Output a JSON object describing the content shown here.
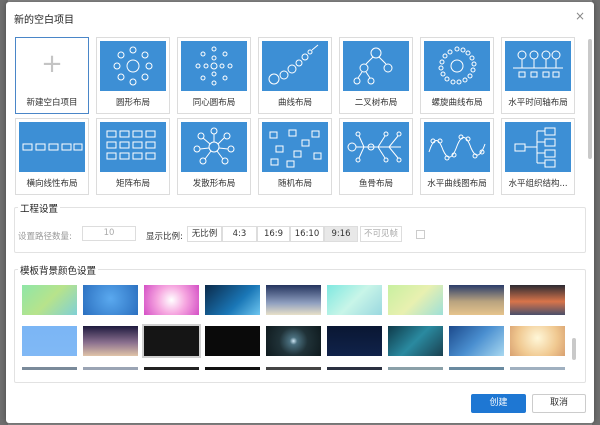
{
  "dialog": {
    "title": "新的空白项目",
    "close_icon": "×"
  },
  "templates": [
    {
      "label": "新建空白项目",
      "icon": "plus-icon",
      "selected": true
    },
    {
      "label": "圆形布局",
      "icon": "circular-layout-icon"
    },
    {
      "label": "同心圆布局",
      "icon": "concentric-layout-icon"
    },
    {
      "label": "曲线布局",
      "icon": "curve-layout-icon"
    },
    {
      "label": "二叉树布局",
      "icon": "binary-tree-layout-icon"
    },
    {
      "label": "螺旋曲线布局",
      "icon": "spiral-layout-icon"
    },
    {
      "label": "水平时间轴布局",
      "icon": "horizontal-timeline-icon"
    },
    {
      "label": "横向线性布局",
      "icon": "horizontal-linear-icon"
    },
    {
      "label": "矩阵布局",
      "icon": "matrix-layout-icon"
    },
    {
      "label": "发散形布局",
      "icon": "radial-layout-icon"
    },
    {
      "label": "随机布局",
      "icon": "random-layout-icon"
    },
    {
      "label": "鱼骨布局",
      "icon": "fishbone-layout-icon"
    },
    {
      "label": "水平曲线图布局",
      "icon": "horizontal-curve-icon"
    },
    {
      "label": "水平组织结构...",
      "icon": "org-chart-icon"
    }
  ],
  "project_settings": {
    "title": "工程设置",
    "path_depth_label": "设置路径数量:",
    "path_depth_value": "10",
    "ratio_label": "显示比例:",
    "ratios": [
      "无比例",
      "4:3",
      "16:9",
      "16:10",
      "9:16"
    ],
    "active_ratio": "9:16",
    "invisible_label": "不可见帧"
  },
  "background": {
    "title": "模板背景颜色设置",
    "swatches": [
      "linear-gradient(135deg,#8fe6a8,#b7e38b,#7fd0d6)",
      "radial-gradient(circle at 50% 45%,#5aa9ef,#2b6fbf)",
      "radial-gradient(circle at 50% 50%,#ffffff,#f6a7e0 45%,#d44fc5)",
      "linear-gradient(135deg,#0b2a4a,#1a77b7 60%,#6ec6f0)",
      "linear-gradient(180deg,#24345e,#8f9fbf 60%,#e8e0c8)",
      "linear-gradient(135deg,#7fe8e0,#c8f5e8,#9ad8e0)",
      "linear-gradient(135deg,#c8f0a0,#e8f0b0,#9ee0d8)",
      "linear-gradient(180deg,#2b3d6a,#b9a37f 55%,#e6c48c)",
      "linear-gradient(180deg,#2c2a32,#d8744a 55%,#4a4f6a)",
      "linear-gradient(180deg,#7bb6f5,#80b8f5)",
      "linear-gradient(180deg,#1e1a3e,#8a6f8e 55%,#e0c4a8)",
      "#151515",
      "#0a0a0a",
      "radial-gradient(circle at 50% 50%,#cfe7f5 0%,#4a6f7e 12%,#203238 45%,#0f1a1e)",
      "linear-gradient(180deg,#0a1733,#10224a)",
      "linear-gradient(135deg,#0e3a4a,#2a8aa0 50%,#1a4050)",
      "linear-gradient(135deg,#1c4a8c,#4a8fd0 50%,#a8d8f0)",
      "radial-gradient(circle at 50% 40%,#fff7d8,#f0c890 60%,#d8a070)"
    ],
    "selected_index": 11
  },
  "buttons": {
    "create": "创建",
    "cancel": "取消"
  },
  "colors": {
    "accent": "#1e77d3",
    "thumb": "#3d8fd5"
  }
}
